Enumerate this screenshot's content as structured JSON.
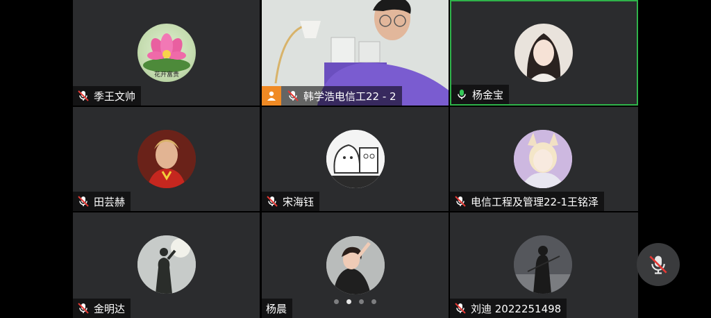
{
  "participants": [
    {
      "name": "季王文帅",
      "mic": "muted",
      "avatar_caption": "花开富贵",
      "avatar_icon": "lotus-flower"
    },
    {
      "name": "韩学浩电信工22 - 2",
      "mic": "muted",
      "video": true
    },
    {
      "name": "杨金宝",
      "mic": "on",
      "active_speaker": true,
      "avatar_icon": "portrait"
    },
    {
      "name": "田芸赫",
      "mic": "muted",
      "avatar_icon": "portrait"
    },
    {
      "name": "宋海钰",
      "mic": "muted",
      "avatar_icon": "cartoon"
    },
    {
      "name": "电信工程及管理22-1王铭泽",
      "mic": "muted",
      "avatar_icon": "anime"
    },
    {
      "name": "金明达",
      "mic": "muted",
      "avatar_icon": "silhouette"
    },
    {
      "name": "杨晨",
      "mic": "none",
      "avatar_icon": "portrait"
    },
    {
      "name": "刘迪 2022251498",
      "mic": "muted",
      "avatar_icon": "portrait"
    }
  ],
  "pagination": {
    "pages": 4,
    "current": 2
  },
  "colors": {
    "active_border": "#2fb34a",
    "muted_red": "#e53935",
    "mic_green": "#35c759",
    "badge_orange": "#f08a24",
    "tile_bg": "#2b2c2e"
  },
  "controls": {
    "floating_mic": "muted"
  }
}
